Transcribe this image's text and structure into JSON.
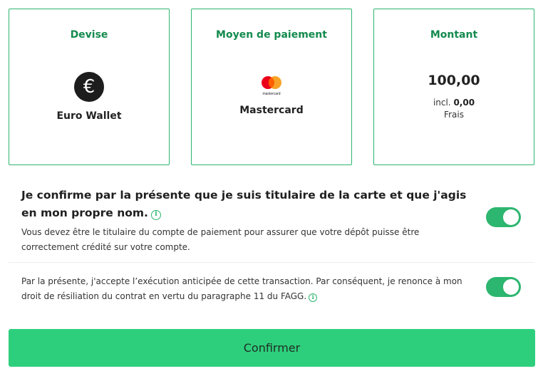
{
  "cards": {
    "currency": {
      "title": "Devise",
      "icon": "euro-icon",
      "icon_glyph": "€",
      "value": "Euro Wallet"
    },
    "payment_method": {
      "title": "Moyen de paiement",
      "icon": "mastercard-logo-icon",
      "logo_text": "mastercard",
      "value": "Mastercard"
    },
    "amount": {
      "title": "Montant",
      "value": "100,00",
      "fee_prefix": "incl.",
      "fee_value": "0,00",
      "fee_label": "Frais"
    }
  },
  "consent_holder": {
    "title": "Je confirme par la présente que je suis titulaire de la carte et que j'agis en mon propre nom.",
    "info_glyph": "i",
    "description": "Vous devez être le titulaire du compte de paiement pour assurer que votre dépôt puisse être correctement crédité sur votre compte.",
    "toggle_on": true
  },
  "consent_early_execution": {
    "text": "Par la présente, j'accepte l’exécution anticipée de cette transaction. Par conséquent, je renonce à mon droit de résiliation du contrat en vertu du paragraphe 11 du FAGG.",
    "info_glyph": "i",
    "toggle_on": true
  },
  "confirm_button": {
    "label": "Confirmer"
  },
  "colors": {
    "accent": "#2db66f",
    "title_green": "#138a4e",
    "button": "#2ecf7c"
  }
}
